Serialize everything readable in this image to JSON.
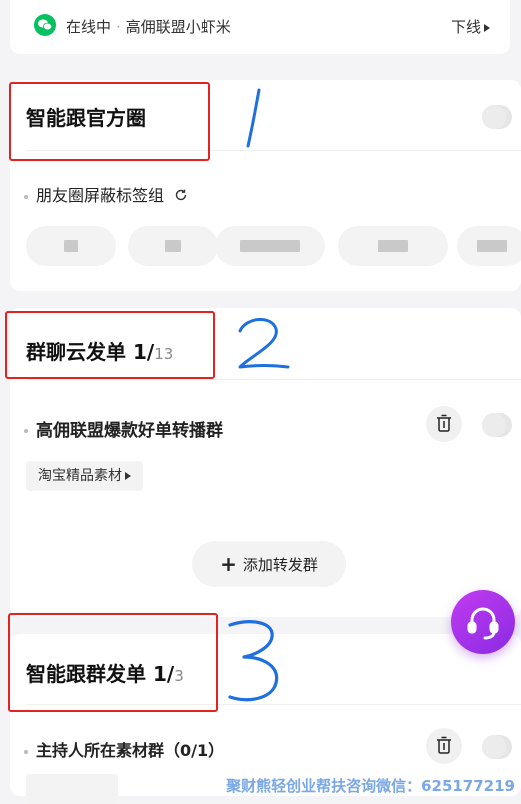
{
  "status": {
    "online": "在线中",
    "account": "高佣联盟小虾米",
    "logout": "下线"
  },
  "sections": {
    "moments": {
      "title": "智能跟官方圈",
      "row_label": "朋友圈屏蔽标签组"
    },
    "group_send": {
      "title_prefix": "群聊云发单 ",
      "count": "1/",
      "total": "13",
      "group_name": "高佣联盟爆款好单转播群",
      "material": "淘宝精品素材",
      "add_button": "添加转发群"
    },
    "smart_group": {
      "title_prefix": "智能跟群发单 ",
      "count": "1/",
      "total": "3",
      "row_label": "主持人所在素材群（0/1）"
    }
  },
  "annotations": [
    "1",
    "2",
    "3"
  ],
  "watermark": "聚财熊轻创业帮扶咨询微信：625177219",
  "colors": {
    "wechat_green": "#07c160",
    "annotation_red": "#e32222",
    "annotation_blue": "#1e6fe0",
    "fab_purple": "#a436ea",
    "watermark_blue": "#7aa7e6"
  },
  "icons": {
    "status": "wechat-icon",
    "refresh": "refresh-icon",
    "delete": "trash-icon",
    "fab": "headset-icon"
  }
}
